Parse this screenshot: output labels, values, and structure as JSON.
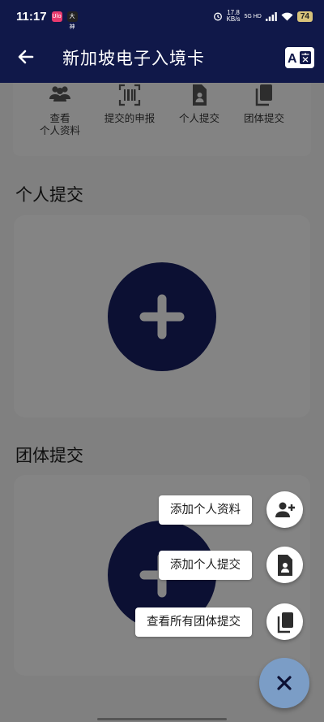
{
  "status_bar": {
    "time": "11:17",
    "app_icon_1": "Ulo",
    "app_icon_2": "大神",
    "speed_value": "17.8",
    "speed_unit": "KB/s",
    "network": "5G HD",
    "battery": "74"
  },
  "app_bar": {
    "title": "新加坡电子入境卡",
    "back_icon": "arrow-left-icon",
    "language_icon": "translate-icon"
  },
  "quick_actions": [
    {
      "label_line1": "查看",
      "label_line2": "个人资料",
      "icon": "people-icon"
    },
    {
      "label_line1": "提交的申报",
      "label_line2": "",
      "icon": "barcode-scan-icon"
    },
    {
      "label_line1": "个人提交",
      "label_line2": "",
      "icon": "person-document-icon"
    },
    {
      "label_line1": "团体提交",
      "label_line2": "",
      "icon": "copy-documents-icon"
    }
  ],
  "sections": {
    "individual_title": "个人提交",
    "group_title": "团体提交"
  },
  "speed_dial": {
    "add_profile": "添加个人资料",
    "add_individual": "添加个人提交",
    "view_group": "查看所有团体提交"
  },
  "colors": {
    "app_bar": "#101849",
    "plus_circle": "#0c1033",
    "main_fab": "#7b9dc6"
  }
}
